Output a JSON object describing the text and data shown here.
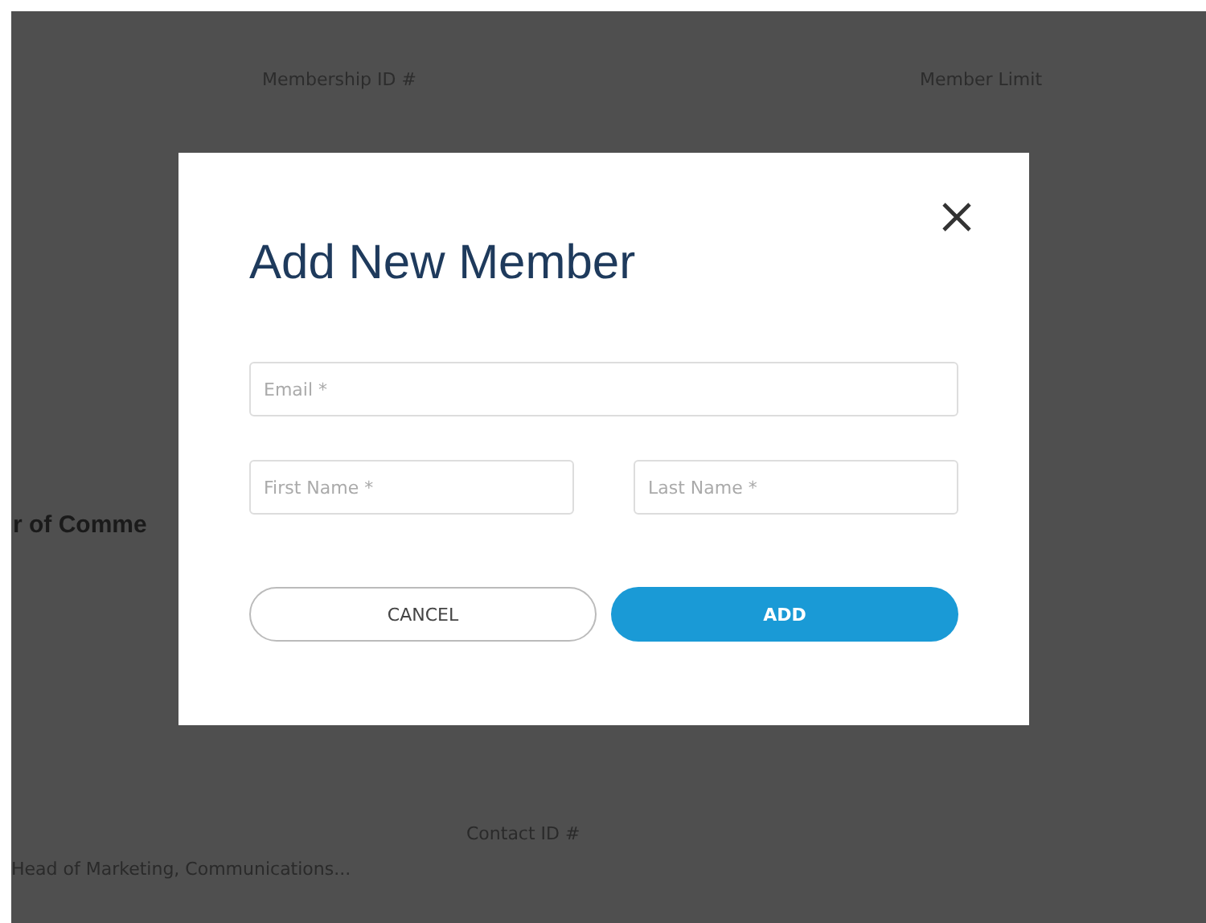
{
  "background": {
    "header_fields": [
      {
        "label": "Membership ID #"
      },
      {
        "label": "Member Limit"
      }
    ],
    "organization_name": "r of Comme",
    "contact": {
      "title": "Head of Marketing, Communications...",
      "field_label": "Contact ID #"
    }
  },
  "modal": {
    "title": "Add New Member",
    "fields": [
      {
        "placeholder": "Email *",
        "kind": "wide"
      },
      {
        "placeholder": "First Name *",
        "kind": "narrow"
      },
      {
        "placeholder": "Last Name *",
        "kind": "narrow"
      }
    ],
    "buttons": [
      {
        "label": "CANCEL",
        "kind": "secondary"
      },
      {
        "label": "ADD",
        "kind": "primary"
      }
    ]
  }
}
